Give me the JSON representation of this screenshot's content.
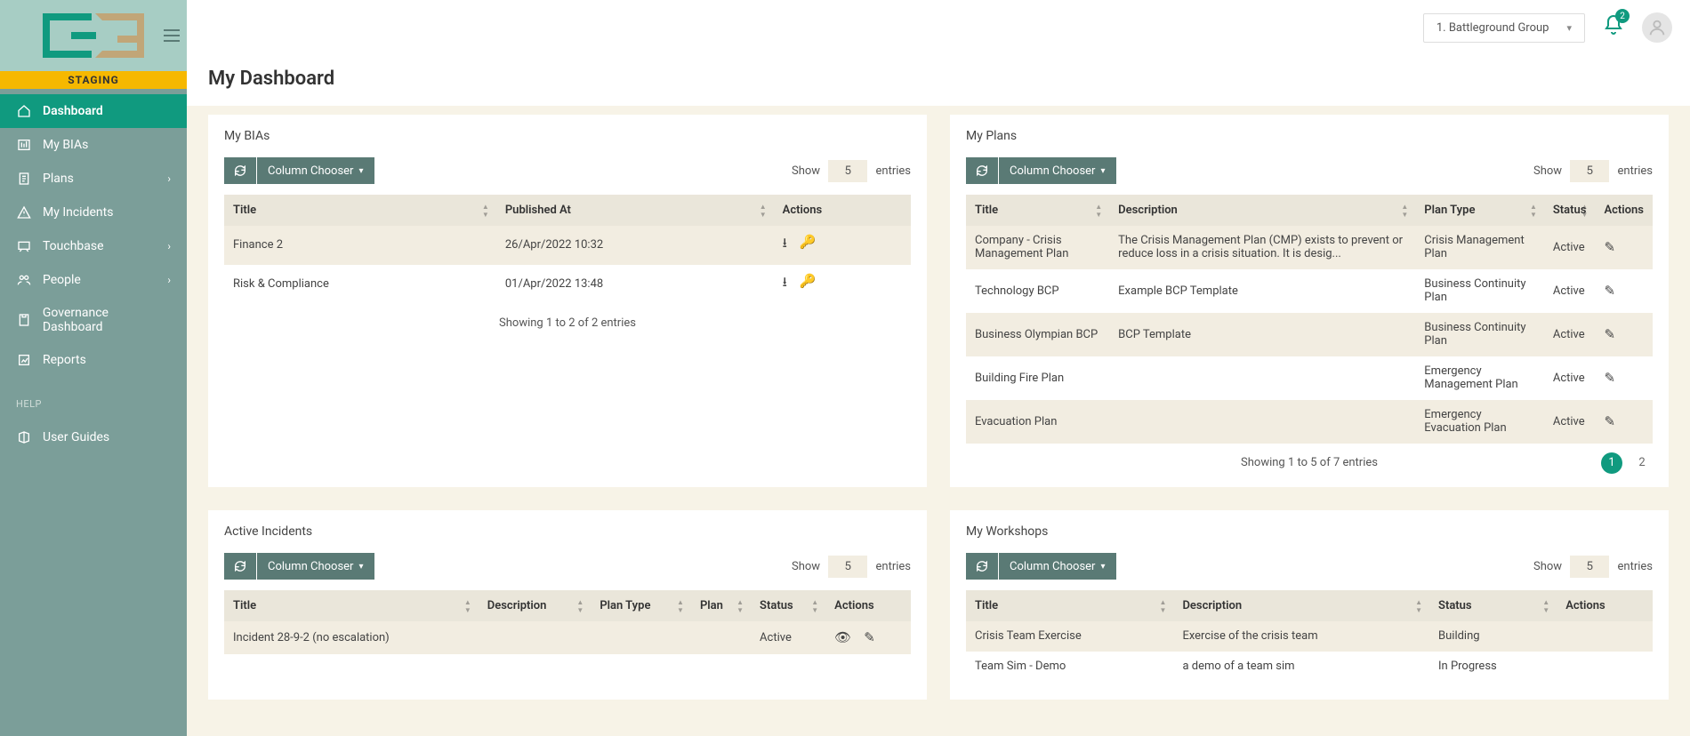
{
  "branding": {
    "staging": "STAGING"
  },
  "topbar": {
    "account": "1. Battleground Group",
    "notifications": "2"
  },
  "sidebar": {
    "items": [
      {
        "label": "Dashboard",
        "icon": "home"
      },
      {
        "label": "My BIAs",
        "icon": "bia"
      },
      {
        "label": "Plans",
        "icon": "plans",
        "chevron": true
      },
      {
        "label": "My Incidents",
        "icon": "incidents"
      },
      {
        "label": "Touchbase",
        "icon": "touchbase",
        "chevron": true
      },
      {
        "label": "People",
        "icon": "people",
        "chevron": true
      },
      {
        "label": "Governance Dashboard",
        "icon": "governance"
      },
      {
        "label": "Reports",
        "icon": "reports"
      }
    ],
    "help_label": "HELP",
    "user_guides": "User Guides"
  },
  "page": {
    "title": "My Dashboard"
  },
  "common": {
    "column_chooser": "Column Chooser",
    "show": "Show",
    "entries": "entries"
  },
  "bias": {
    "title": "My BIAs",
    "page_size": "5",
    "columns": [
      "Title",
      "Published At",
      "Actions"
    ],
    "rows": [
      {
        "title": "Finance 2",
        "published": "26/Apr/2022 10:32"
      },
      {
        "title": "Risk & Compliance",
        "published": "01/Apr/2022 13:48"
      }
    ],
    "footer": "Showing 1 to 2 of 2 entries"
  },
  "plans": {
    "title": "My Plans",
    "page_size": "5",
    "columns": [
      "Title",
      "Description",
      "Plan Type",
      "Status",
      "Actions"
    ],
    "rows": [
      {
        "title": "Company - Crisis Management Plan",
        "description": "The Crisis Management Plan (CMP) exists to prevent or reduce loss in a crisis situation. It is desig...",
        "type": "Crisis Management Plan",
        "status": "Active"
      },
      {
        "title": "Technology BCP",
        "description": "Example BCP Template",
        "type": "Business Continuity Plan",
        "status": "Active"
      },
      {
        "title": "Business Olympian BCP",
        "description": "BCP Template",
        "type": "Business Continuity Plan",
        "status": "Active"
      },
      {
        "title": "Building Fire Plan",
        "description": "",
        "type": "Emergency Management Plan",
        "status": "Active"
      },
      {
        "title": "Evacuation Plan",
        "description": "",
        "type": "Emergency Evacuation Plan",
        "status": "Active"
      }
    ],
    "footer": "Showing 1 to 5 of 7 entries",
    "pages": [
      "1",
      "2"
    ]
  },
  "incidents": {
    "title": "Active Incidents",
    "page_size": "5",
    "columns": [
      "Title",
      "Description",
      "Plan Type",
      "Plan",
      "Status",
      "Actions"
    ],
    "rows": [
      {
        "title": "Incident 28-9-2 (no escalation)",
        "description": "",
        "plan_type": "",
        "plan": "",
        "status": "Active"
      }
    ]
  },
  "workshops": {
    "title": "My Workshops",
    "page_size": "5",
    "columns": [
      "Title",
      "Description",
      "Status",
      "Actions"
    ],
    "rows": [
      {
        "title": "Crisis Team Exercise",
        "description": "Exercise of the crisis team",
        "status": "Building"
      },
      {
        "title": "Team Sim - Demo",
        "description": "a demo of a team sim",
        "status": "In Progress"
      }
    ]
  }
}
